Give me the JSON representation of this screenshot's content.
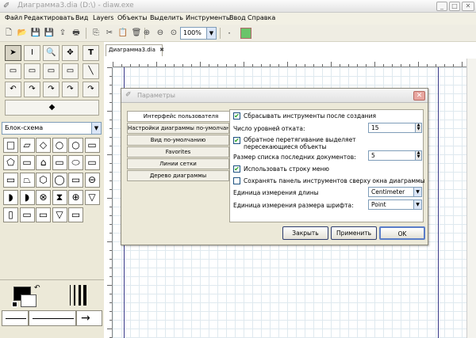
{
  "window": {
    "title": "Диаграмма3.dia (D:\\) - diaw.exe",
    "minimize": "_",
    "maximize": "□",
    "close": "✕"
  },
  "menu": [
    "Файл",
    "Редактировать",
    "Вид",
    "Layers",
    "Объекты",
    "Выделить",
    "Инструменты",
    "Ввод",
    "Справка"
  ],
  "toolbar": {
    "zoom": "100%",
    "zoom_arrow": "▼"
  },
  "toolbox": {
    "tools": [
      "➤",
      "I",
      "🔍",
      "✥",
      "T",
      "▭",
      "▭",
      "▭",
      "▭",
      "╲",
      "↶",
      "↷",
      "↷",
      "↷",
      "↷",
      "◆"
    ],
    "shape_set": "Блок-схема",
    "shapes": [
      "□",
      "▱",
      "◇",
      "○",
      "○",
      "▭",
      "⬠",
      "▭",
      "⌂",
      "▭",
      "⬭",
      "▭",
      "▭",
      "⏢",
      "⬡",
      "◯",
      "▭",
      "⊖",
      "◗",
      "◗",
      "⊗",
      "⧗",
      "⊕",
      "▽",
      "▯",
      "▭",
      "▭",
      "▽",
      "▭"
    ]
  },
  "document": {
    "tab": "Диаграмма3.dia",
    "tab_close": "✖"
  },
  "dialog": {
    "title": "Параметры",
    "close": "✕",
    "tabs": [
      "Интерфейс пользователя",
      "Настройки диаграммы по-умолчанию",
      "Вид по-умолчанию",
      "Favorites",
      "Линии сетки",
      "Дерево диаграммы"
    ],
    "options": {
      "reset_tools": "Сбрасывать инструменты после создания",
      "undo_levels_label": "Число уровней отката:",
      "undo_levels_value": "15",
      "reverse_drag": "Обратное перетягивание выделяет пересекающиеся объекты",
      "recent_docs_label": "Размер списка последних документов:",
      "recent_docs_value": "5",
      "use_menu_bar": "Использовать строку меню",
      "keep_toolbox": "Сохранять панель инструментов сверху окна диаграммы",
      "length_unit_label": "Единица измерения длины",
      "length_unit_value": "Centimeter",
      "font_unit_label": "Единица измерения размера шрифта:",
      "font_unit_value": "Point"
    },
    "checked": {
      "reset_tools": true,
      "reverse_drag": true,
      "use_menu_bar": true,
      "keep_toolbox": false
    },
    "buttons": {
      "close": "Закрыть",
      "apply": "Применить",
      "ok": "OK"
    }
  }
}
